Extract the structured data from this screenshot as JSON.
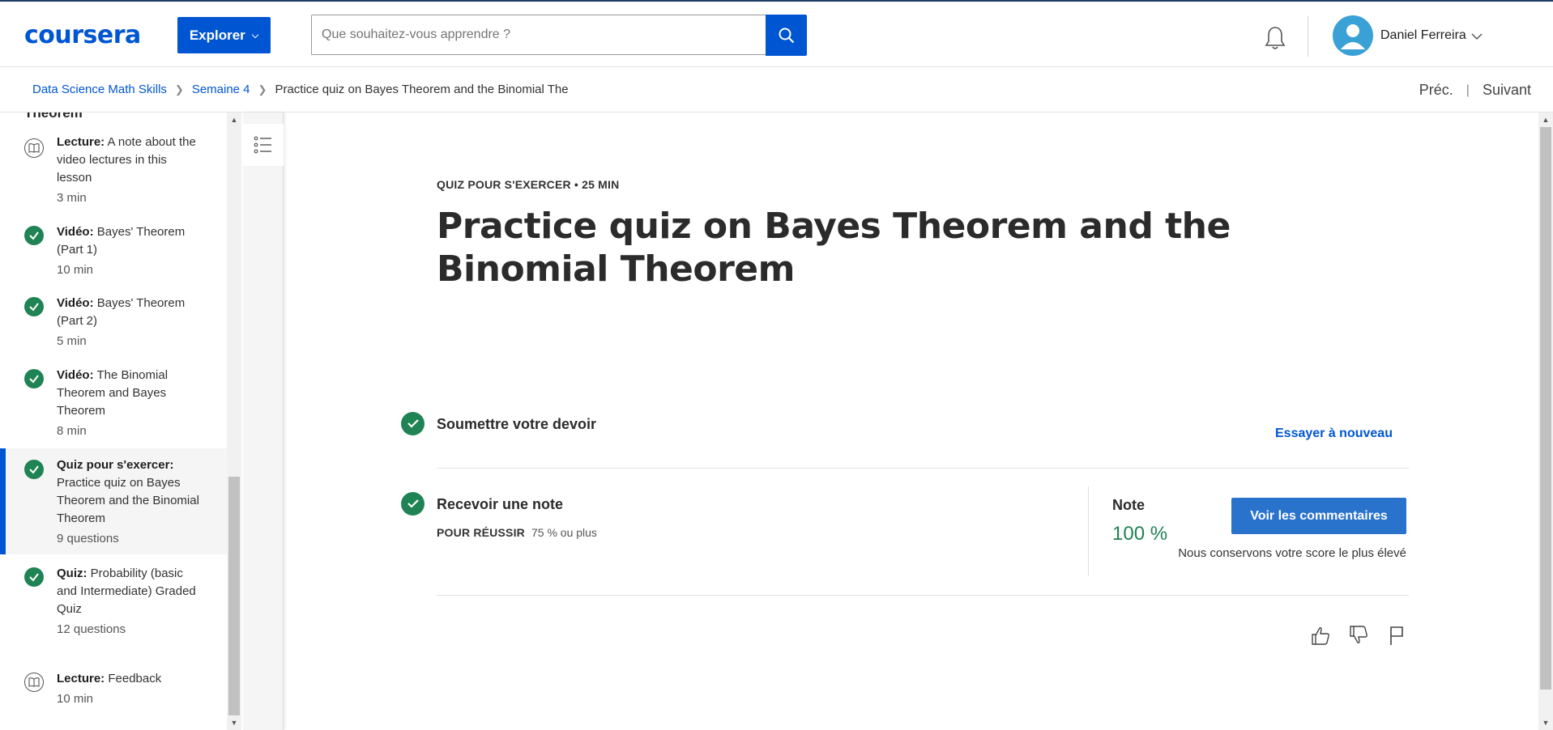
{
  "header": {
    "logo": "coursera",
    "explore_label": "Explorer",
    "search_placeholder": "Que souhaitez-vous apprendre ?",
    "username": "Daniel Ferreira"
  },
  "breadcrumb": {
    "items": [
      "Data Science Math Skills",
      "Semaine 4"
    ],
    "current": "Practice quiz on Bayes Theorem and the Binomial The",
    "prev": "Préc.",
    "next": "Suivant"
  },
  "sidebar": {
    "top_partial": "Theorem",
    "items": [
      {
        "type": "Lecture:",
        "title": "A note about the video lectures in this lesson",
        "meta": "3 min",
        "status": "book-icon"
      },
      {
        "type": "Vidéo:",
        "title": "Bayes' Theorem (Part 1)",
        "meta": "10 min",
        "status": "check-icon"
      },
      {
        "type": "Vidéo:",
        "title": "Bayes' Theorem (Part 2)",
        "meta": "5 min",
        "status": "check-icon"
      },
      {
        "type": "Vidéo:",
        "title": "The Binomial Theorem and Bayes Theorem",
        "meta": "8 min",
        "status": "check-icon"
      },
      {
        "type": "Quiz pour s'exercer:",
        "title": "Practice quiz on Bayes Theorem and the Binomial Theorem",
        "meta": "9 questions",
        "status": "check-icon"
      },
      {
        "type": "Quiz:",
        "title": "Probability (basic and Intermediate) Graded Quiz",
        "meta": "12 questions",
        "status": "check-icon"
      },
      {
        "type": "Lecture:",
        "title": "Feedback",
        "meta": "10 min",
        "status": "book-icon"
      }
    ]
  },
  "main": {
    "kicker": "QUIZ POUR S'EXERCER • 25 MIN",
    "title": "Practice quiz on Bayes Theorem and the Binomial Theorem",
    "submit_title": "Soumettre votre devoir",
    "retry_label": "Essayer à nouveau",
    "receive_title": "Recevoir une note",
    "pass_label": "POUR RÉUSSIR",
    "pass_value": "75 % ou plus",
    "grade_label": "Note",
    "grade_value": "100 %",
    "feedback_button": "Voir les commentaires",
    "keep_note": "Nous conservons votre score le plus élevé"
  },
  "colors": {
    "brand": "#0056d2",
    "success": "#1f8354",
    "button": "#2a73cc"
  }
}
